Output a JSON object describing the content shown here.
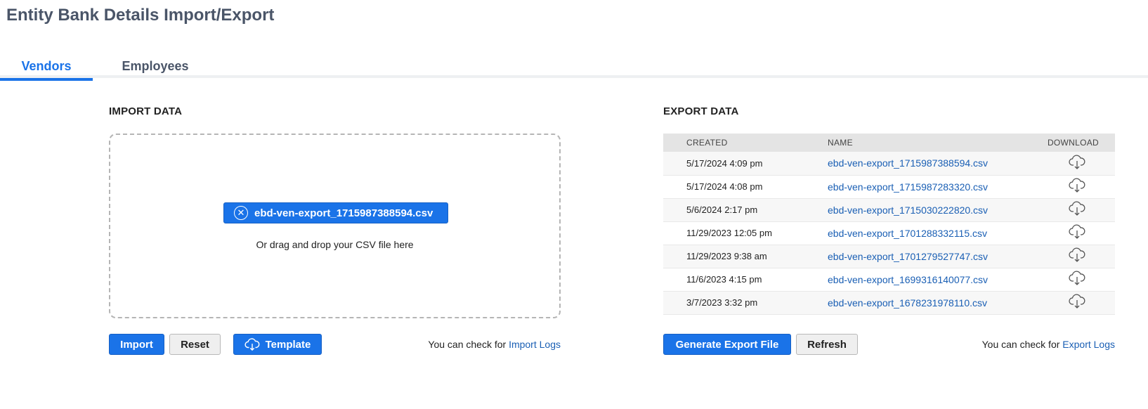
{
  "page": {
    "title": "Entity Bank Details Import/Export"
  },
  "tabs": [
    {
      "label": "Vendors",
      "active": true
    },
    {
      "label": "Employees",
      "active": false
    }
  ],
  "import_section": {
    "heading": "IMPORT DATA",
    "selected_file": "ebd-ven-export_1715987388594.csv",
    "drop_hint": "Or drag and drop your CSV file here",
    "buttons": {
      "import": "Import",
      "reset": "Reset",
      "template": "Template"
    },
    "log_note": "You can check for",
    "log_link": "Import Logs"
  },
  "export_section": {
    "heading": "EXPORT DATA",
    "columns": {
      "created": "CREATED",
      "name": "NAME",
      "download": "DOWNLOAD"
    },
    "rows": [
      {
        "created": "5/17/2024 4:09 pm",
        "name": "ebd-ven-export_1715987388594.csv"
      },
      {
        "created": "5/17/2024 4:08 pm",
        "name": "ebd-ven-export_1715987283320.csv"
      },
      {
        "created": "5/6/2024 2:17 pm",
        "name": "ebd-ven-export_1715030222820.csv"
      },
      {
        "created": "11/29/2023 12:05 pm",
        "name": "ebd-ven-export_1701288332115.csv"
      },
      {
        "created": "11/29/2023 9:38 am",
        "name": "ebd-ven-export_1701279527747.csv"
      },
      {
        "created": "11/6/2023 4:15 pm",
        "name": "ebd-ven-export_1699316140077.csv"
      },
      {
        "created": "3/7/2023 3:32 pm",
        "name": "ebd-ven-export_1678231978110.csv"
      }
    ],
    "buttons": {
      "generate": "Generate Export File",
      "refresh": "Refresh"
    },
    "log_note": "You can check for",
    "log_link": "Export Logs"
  },
  "icons": {
    "chip_remove": "close-circle-icon",
    "template": "cloud-download-icon",
    "row_download": "cloud-download-icon"
  },
  "colors": {
    "accent": "#1a73e8",
    "link": "#1a5fb4",
    "title": "#4a5568"
  }
}
